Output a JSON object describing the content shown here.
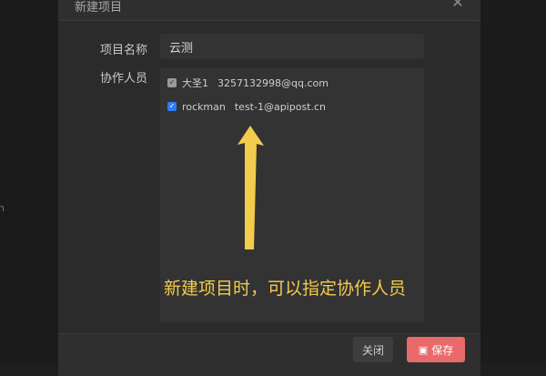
{
  "modal": {
    "title": "新建项目",
    "close_icon": "close-icon",
    "fields": {
      "name_label": "项目名称",
      "name_value": "云测",
      "members_label": "协作人员"
    },
    "members": [
      {
        "name": "大圣1",
        "email": "3257132998@qq.com",
        "checked": true,
        "style": "gray"
      },
      {
        "name": "rockman",
        "email": "test-1@apipost.cn",
        "checked": true,
        "style": "blue"
      }
    ],
    "buttons": {
      "close_label": "关闭",
      "save_label": "保存",
      "save_icon": "save-icon"
    }
  },
  "backdrop_text": "n",
  "annotation": {
    "text": "新建项目时，可以指定协作人员",
    "color": "#f2cc4b"
  },
  "colors": {
    "accent_blue": "#2f7bf5",
    "save_button": "#e86a6a"
  }
}
